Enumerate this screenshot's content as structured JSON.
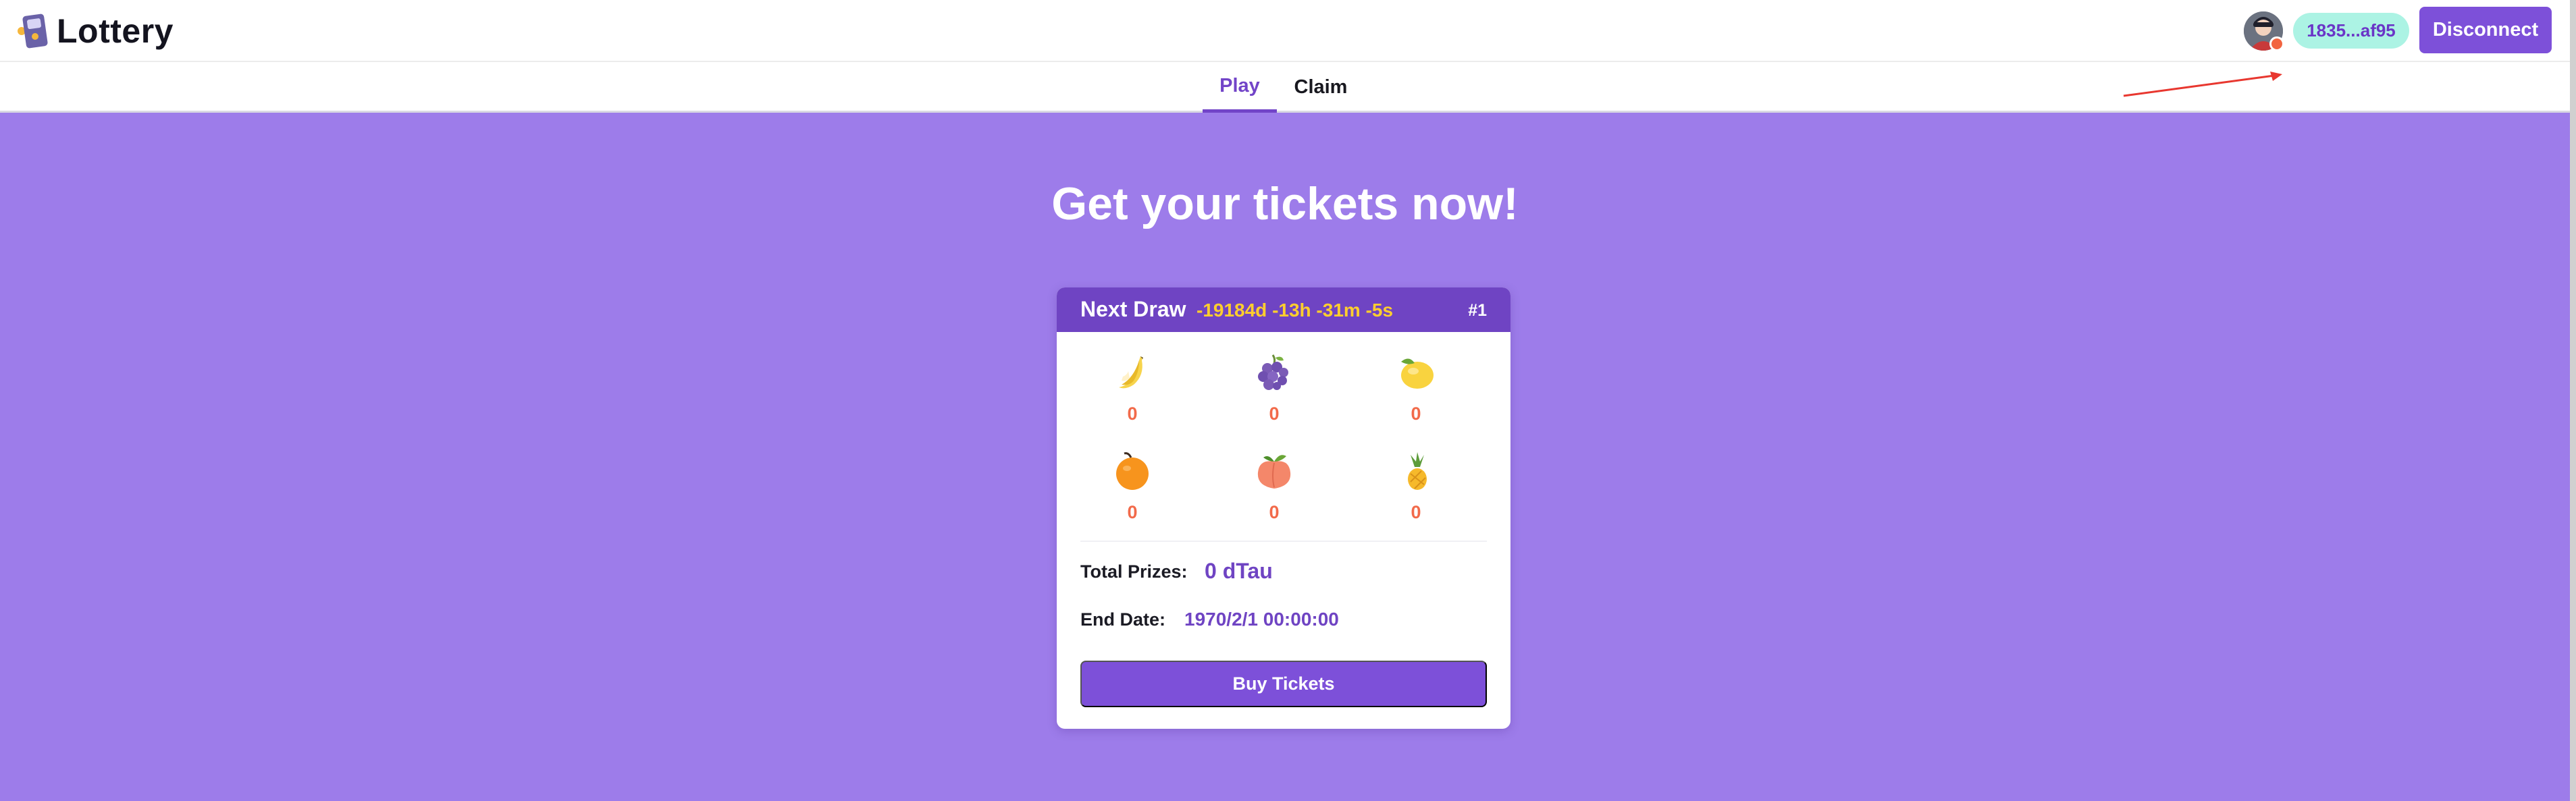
{
  "header": {
    "app_title": "Lottery",
    "account": {
      "address": "1835...af95",
      "status_color": "#f26440"
    },
    "disconnect_label": "Disconnect"
  },
  "tabs": [
    {
      "label": "Play",
      "active": true
    },
    {
      "label": "Claim",
      "active": false
    }
  ],
  "hero": {
    "title": "Get your tickets now!"
  },
  "draw_card": {
    "next_draw_label": "Next Draw",
    "countdown": "-19184d -13h -31m -5s",
    "draw_number": "#1",
    "fruits": [
      {
        "icon": "banana-icon",
        "count": "0"
      },
      {
        "icon": "grapes-icon",
        "count": "0"
      },
      {
        "icon": "lemon-icon",
        "count": "0"
      },
      {
        "icon": "orange-icon",
        "count": "0"
      },
      {
        "icon": "peach-icon",
        "count": "0"
      },
      {
        "icon": "pineapple-icon",
        "count": "0"
      }
    ],
    "total_prizes_label": "Total Prizes:",
    "total_prizes_value": "0 dTau",
    "end_date_label": "End Date:",
    "end_date_value": "1970/2/1 00:00:00",
    "buy_button_label": "Buy Tickets"
  },
  "colors": {
    "brand_purple": "#7d50d9",
    "hero_background": "#9d7cea",
    "countdown_yellow": "#ffce2e",
    "count_red": "#f26a4a",
    "address_pill": "#acf3e4"
  }
}
